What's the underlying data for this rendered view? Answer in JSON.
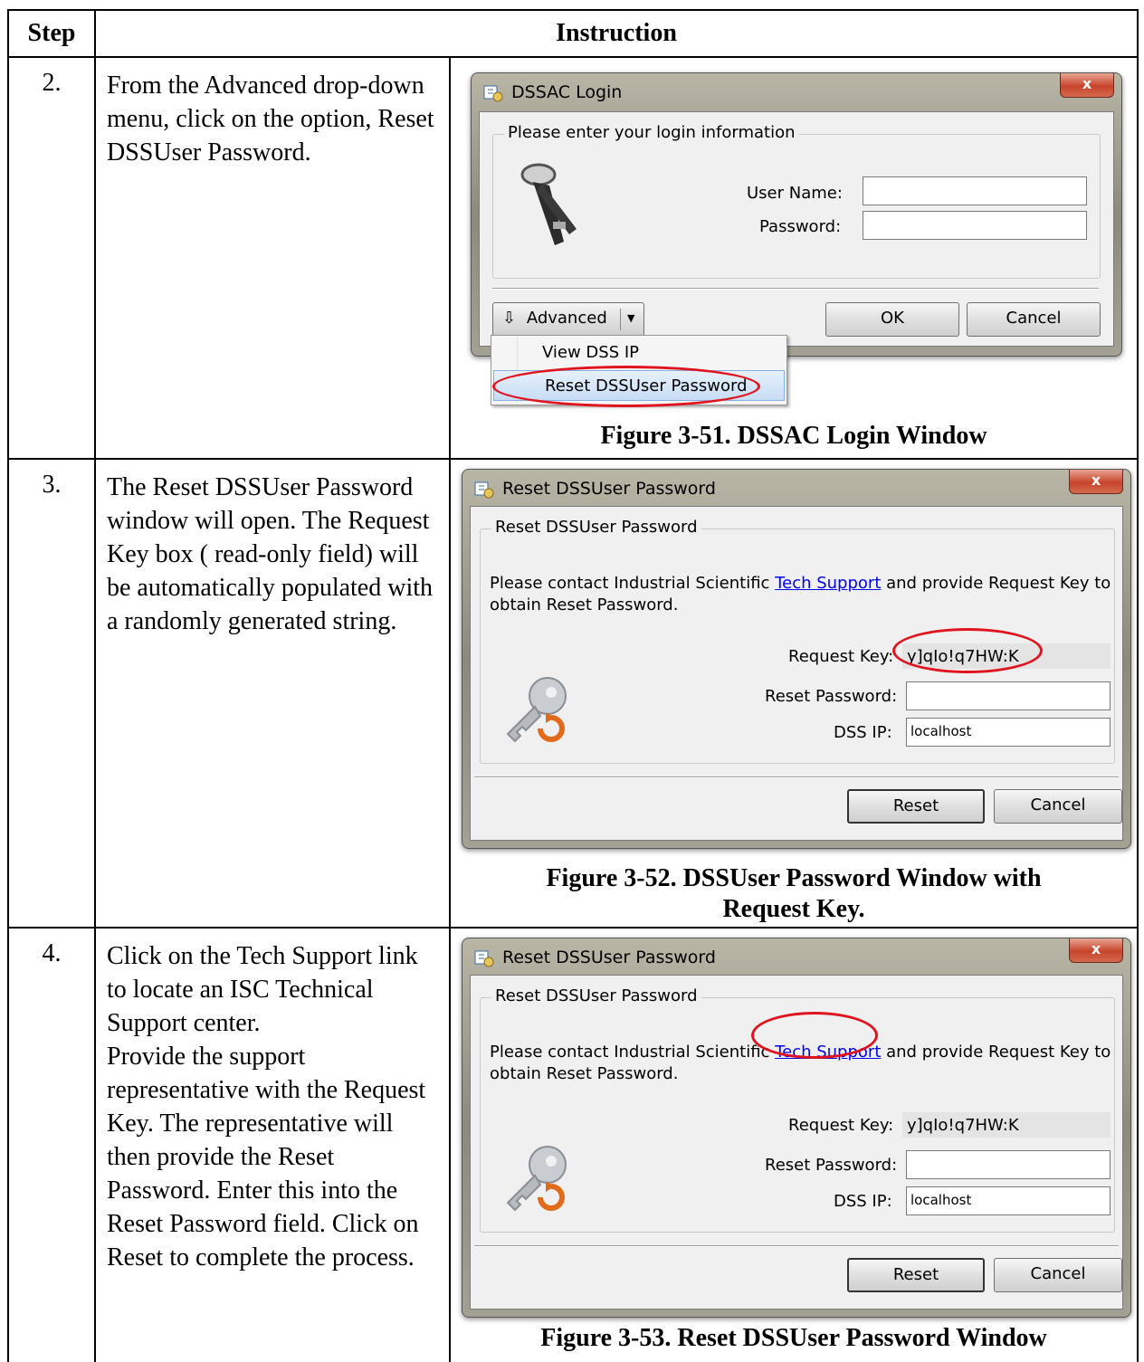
{
  "table": {
    "header_step": "Step",
    "header_instruction": "Instruction"
  },
  "rows": [
    {
      "step": "2.",
      "instruction": [
        "From the Advanced drop-down menu, click on the option, Reset DSSUser Password."
      ],
      "caption": "Figure 3-51.  DSSAC Login Window"
    },
    {
      "step": "3.",
      "instruction": [
        "The Reset DSSUser Password window will open. The Request Key box ( read-only field) will be automatically populated with a randomly generated string."
      ],
      "caption": "Figure 3-52.  DSSUser Password Window with Request Key."
    },
    {
      "step": "4.",
      "instruction": [
        "Click on the Tech Support link to locate an ISC Technical Support center.",
        "Provide the support representative with the Request Key. The representative will then provide the Reset Password. Enter this into the Reset Password field. Click on Reset to complete the process."
      ],
      "caption": "Figure 3-53.  Reset DSSUser Password Window"
    }
  ],
  "login_dialog": {
    "title": "DSSAC Login",
    "close": "x",
    "group_title": "Please enter your login information",
    "user_name_label": "User Name:",
    "password_label": "Password:",
    "user_name_value": "",
    "password_value": "",
    "advanced_button": "Advanced",
    "ok_button": "OK",
    "cancel_button": "Cancel",
    "menu_items": [
      "View DSS IP",
      "Reset DSSUser Password"
    ]
  },
  "reset_dialog": {
    "title": "Reset DSSUser Password",
    "close": "x",
    "group_title": "Reset DSSUser Password",
    "message_pre": "Please contact Industrial Scientific ",
    "message_link": "Tech Support",
    "message_post": " and provide Request Key to",
    "message_line2": "obtain Reset Password.",
    "request_key_label": "Request Key:",
    "request_key_value": "y]qIo!q7HW:K",
    "reset_password_label": "Reset Password:",
    "reset_password_value": "",
    "dss_ip_label": "DSS IP:",
    "dss_ip_value": "localhost",
    "reset_button": "Reset",
    "cancel_button": "Cancel"
  },
  "colors": {
    "highlight_circle": "#e0141e",
    "link": "#0000ee"
  }
}
